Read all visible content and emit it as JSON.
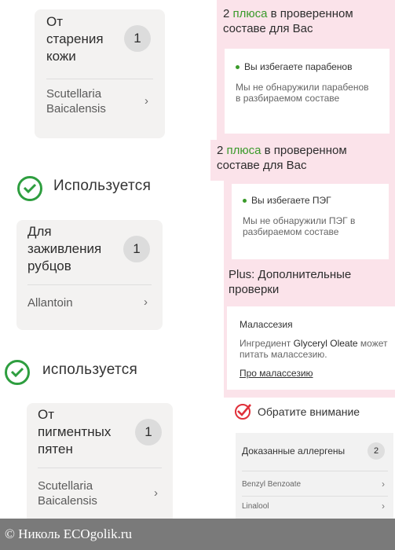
{
  "left": {
    "card1": {
      "title": "От\nстарения\nкожи",
      "count": "1",
      "ingredient": "Scutellaria\nBaicalensis"
    },
    "used_label_1": "Используется",
    "card2": {
      "title": "Для\nзаживления\nрубцов",
      "count": "1",
      "ingredient": "Allantoin"
    },
    "used_label_2": "используется",
    "card3": {
      "title": "От\nпигментных\nпятен",
      "count": "1",
      "ingredient": "Scutellaria\nBaicalensis"
    }
  },
  "right": {
    "block1": {
      "head_pre": "2 ",
      "head_green": "плюса",
      "head_post": " в проверенном составе для Вас",
      "item_title": "Вы избегаете парабенов",
      "item_text": "Мы не обнаружили парабенов в разбираемом составе"
    },
    "block2": {
      "head_pre": "2 ",
      "head_green": "плюса",
      "head_post": " в проверенном составе для Вас",
      "item_title": "Вы избегаете ПЭГ",
      "item_text": "Мы не обнаружили ПЭГ в разбираемом составе"
    },
    "block3": {
      "head": "Plus: Дополнительные проверки",
      "item_title": "Малассезия",
      "text_pre": "Ингредиент ",
      "text_bold": "Glyceryl Oleate",
      "text_post": " может питать малассезию.",
      "link": "Про малассезию"
    },
    "attention": {
      "label": "Обратите внимание",
      "allergens_title": "Доказанные аллергены",
      "allergens_count": "2",
      "items": [
        "Benzyl Benzoate",
        "Linalool"
      ]
    }
  },
  "footer": {
    "text": "© Николь ECOgolik.ru"
  },
  "colors": {
    "accent_green": "#3a9a2a",
    "pink_panel": "#fbe3ea",
    "card_bg": "#f3f2f1",
    "red_check": "#e0303a"
  },
  "icons": [
    "check-circle-icon",
    "chevron-right-icon",
    "red-check-icon"
  ]
}
